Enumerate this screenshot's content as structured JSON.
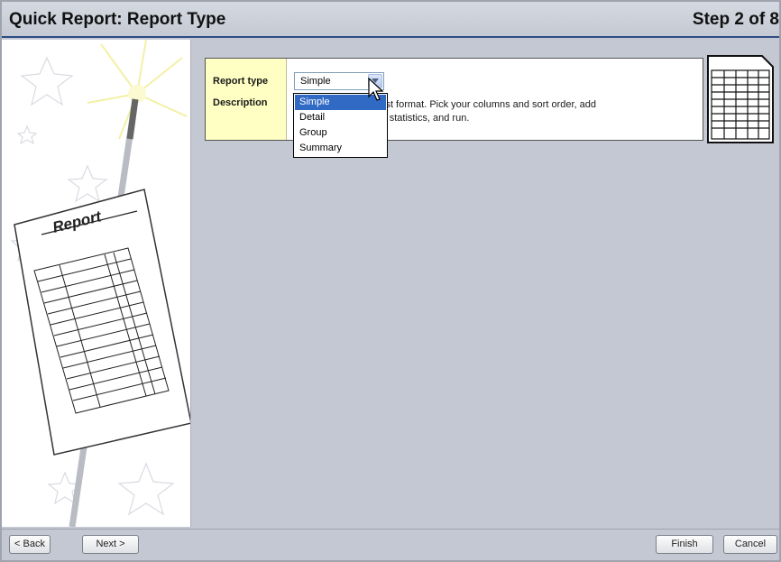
{
  "header": {
    "title": "Quick Report: Report Type",
    "step": "Step 2 of 8"
  },
  "illustration": {
    "report_label": "Report"
  },
  "form": {
    "report_type_label": "Report type",
    "description_label": "Description",
    "selected_value": "Simple",
    "description_text": "ist format. Pick your columns and sort order, add\nr statistics, and run.",
    "options": [
      "Simple",
      "Detail",
      "Group",
      "Summary"
    ],
    "highlighted_option": "Simple"
  },
  "footer": {
    "back_label": "< Back",
    "next_label": "Next >",
    "finish_label": "Finish",
    "cancel_label": "Cancel"
  },
  "colors": {
    "header_rule": "#2e4c83",
    "label_column_bg": "#ffffc4",
    "highlight": "#316ac5",
    "background": "#c3c8d3"
  },
  "icons": [
    "wizard-wand-icon",
    "report-sheet-icon",
    "table-grid-icon",
    "dropdown-arrow-icon",
    "cursor-icon"
  ]
}
